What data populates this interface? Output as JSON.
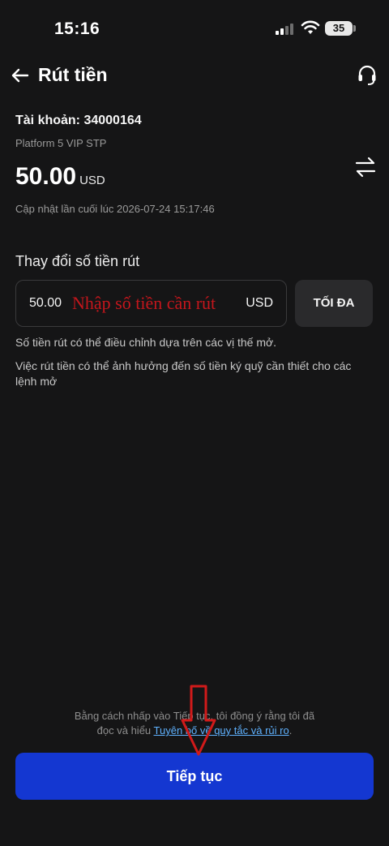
{
  "status_bar": {
    "time": "15:16",
    "battery_level": "35",
    "icons": [
      "cellular-signal-icon",
      "wifi-icon",
      "battery-icon"
    ]
  },
  "header": {
    "title": "Rút tiền",
    "icons": [
      "arrow-left-icon",
      "headset-icon"
    ]
  },
  "account": {
    "label": "Tài khoản: 34000164",
    "platform": "Platform 5 VIP STP",
    "balance": "50.00",
    "currency": "USD",
    "last_updated": "Cập nhật lần cuối lúc 2026-07-24 15:17:46",
    "swap_icon": "swap-arrows-icon"
  },
  "withdraw": {
    "section_title": "Thay đổi số tiền rút",
    "amount_value": "50.00",
    "amount_annotation": "Nhập số tiền cần rút",
    "amount_currency": "USD",
    "max_label": "TỐI ĐA",
    "note_1": "Số tiền rút có thể điều chỉnh dựa trên các vị thế mở.",
    "note_2": "Việc rút tiền có thể ảnh hưởng đến số tiền ký quỹ cần thiết cho các lệnh mở"
  },
  "footer": {
    "agreement_line_1": "Bằng cách nhấp vào Tiếp tục, tôi đồng ý rằng tôi đã",
    "agreement_line_2_prefix": "đọc và hiểu ",
    "agreement_link": "Tuyên bố về quy tắc và rủi ro",
    "agreement_line_2_suffix": ".",
    "continue_label": "Tiếp tục"
  },
  "colors": {
    "background": "#151516",
    "primary_button": "#1437d1",
    "link": "#5fb2ff",
    "annotation_red": "#c4161c"
  }
}
